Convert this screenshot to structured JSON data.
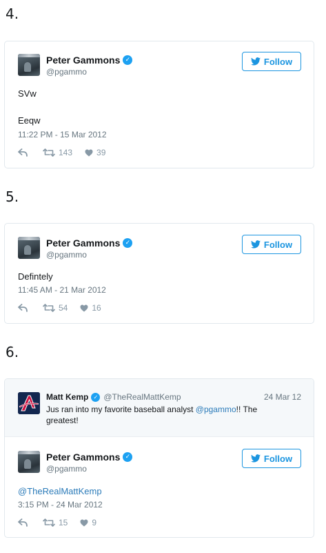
{
  "colors": {
    "accent": "#1b95e0",
    "verified": "#1da1f2",
    "secondary_text": "#66757f",
    "border": "#e1e8ed",
    "quoted_bg": "#f5f8fa",
    "link": "#2b7bb9"
  },
  "sections": [
    {
      "number": "4.",
      "tweet": {
        "name": "Peter Gammons",
        "verified_icon": "verified-check-icon",
        "handle": "@pgammo",
        "follow_label": "Follow",
        "text_line1": "SVw",
        "text_line2": "Eeqw",
        "timestamp": "11:22 PM - 15 Mar 2012",
        "retweets": "143",
        "likes": "39"
      }
    },
    {
      "number": "5.",
      "tweet": {
        "name": "Peter Gammons",
        "handle": "@pgammo",
        "follow_label": "Follow",
        "text": "Defintely",
        "timestamp": "11:45 AM - 21 Mar 2012",
        "retweets": "54",
        "likes": "16"
      }
    },
    {
      "number": "6.",
      "quoted": {
        "name": "Matt Kemp",
        "handle": "@TheRealMattKemp",
        "date": "24 Mar 12",
        "text_before": "Jus ran into my favorite baseball analyst ",
        "mention": "@pgammo",
        "text_after": "!! The greatest!",
        "avatar_icon": "braves-logo-icon"
      },
      "tweet": {
        "name": "Peter Gammons",
        "handle": "@pgammo",
        "follow_label": "Follow",
        "text": "@TheRealMattKemp",
        "timestamp": "3:15 PM - 24 Mar 2012",
        "retweets": "15",
        "likes": "9"
      }
    }
  ]
}
